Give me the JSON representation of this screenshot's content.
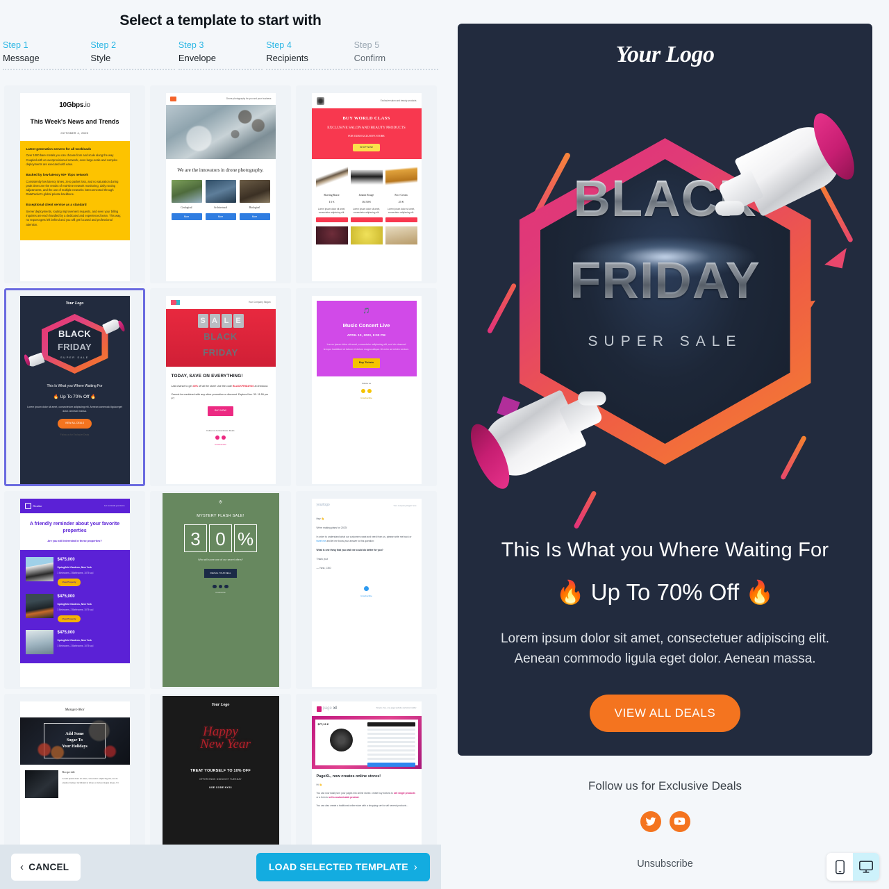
{
  "page": {
    "title": "Select a template to start with"
  },
  "steps": [
    {
      "num": "Step 1",
      "label": "Message",
      "active": true
    },
    {
      "num": "Step 2",
      "label": "Style",
      "active": true
    },
    {
      "num": "Step 3",
      "label": "Envelope",
      "active": true
    },
    {
      "num": "Step 4",
      "label": "Recipients",
      "active": true
    },
    {
      "num": "Step 5",
      "label": "Confirm",
      "active": false
    }
  ],
  "footer": {
    "cancel_label": "CANCEL",
    "load_label": "LOAD SELECTED TEMPLATE"
  },
  "templates": {
    "t1": {
      "logo": "10Gbps",
      "logo_suffix": ".io",
      "headline": "This Week's News and Trends",
      "date": "OCTOBER 4, 2022",
      "s1_title": "Latest generation servers for all workloads",
      "s1_body": "Over 1000 bare metals you can choose from and scale along the way. Coupled with an overprovisioned network, even large-scale and complex deployments are executed with ease.",
      "s2_title": "Backed by low-latency 90+ Tbps network",
      "s2_body": "Consistently low latency times, zero packet loss, and no saturation during peak times are the results of real-time network monitoring, daily routing adjustments, and the use of multiple networks interconnected through DataPacket's global private backbone.",
      "s3_title": "Exceptional client service as a standard",
      "s3_body": "Server deployments, routing improvement requests, and even your billing inquiries are each handled by a dedicated and experienced team. This way, no request gets left behind and you will get focused and professional attention."
    },
    "t2": {
      "tagline": "Drone photography for you and your business",
      "headline": "We are the innovators in drone photography.",
      "cols": [
        {
          "caption": "Geological",
          "button": "More"
        },
        {
          "caption": "Architectural",
          "button": "More"
        },
        {
          "caption": "Biological",
          "button": "More"
        }
      ]
    },
    "t3": {
      "tagline": "Exclusive salon and beauty products",
      "line1": "BUY WORLD CLASS",
      "line2": "EXCLUSIVE SALON AND BEAUTY PRODUCTS",
      "line3": "FOR OUR EXCLUSIVE STORE",
      "cta": "SHOP NOW",
      "products": [
        {
          "name": "Shaving Razor",
          "price": "15 €",
          "desc": "Lorem ipsum dolor sit amet, consectetur adipiscing elit."
        },
        {
          "name": "Jasmin Rouge",
          "price": "16.50 €",
          "desc": "Lorem ipsum dolor sit amet, consectetur adipiscing elit."
        },
        {
          "name": "Face Cream",
          "price": "25 €",
          "desc": "Lorem ipsum dolor sit amet, consectetur adipiscing elit."
        }
      ]
    },
    "t4": {
      "logo": "Your Logo",
      "title1": "BLACK",
      "title2": "FRIDAY",
      "subtitle": "SUPER SALE",
      "headline": "This Is What you Where Waiting For",
      "offer": "🔥 Up To 70% Off 🔥",
      "body": "Lorem ipsum dolor sit amet, consectetuer adipiscing elit. Aenean commodo ligula eget dolor. Aenean massa.",
      "cta": "VIEW ALL DEALS",
      "follow": "Follow us for Exclusive Deals",
      "selected": true
    },
    "t5": {
      "company": "Your Company Slogan",
      "sale": "SALE",
      "black": "BLACK",
      "friday": "FRIDAY",
      "headline": "TODAY, SAVE ON EVERYTHING!",
      "p1_a": "Last chance to get ",
      "p1_code": "40%",
      "p1_b": " off all the store! Use the code ",
      "p1_code2": "BLACKFRIDAY40",
      "p1_c": " at checkout.",
      "p2": "Cannot be combined with any other promotion or discount. Expires Nov. 30. 11:59 pm PT",
      "cta": "BUY NOW",
      "follow": "Follow us for Exclusive Deals",
      "unsubscribe": "Unsubscribe"
    },
    "t6": {
      "title": "Music Concert Live",
      "date": "APRIL 10, 2023, 8:00 PM",
      "body": "Lorem ipsum dolor sit amet, consectetur adipiscing elit, sed do eiusmod tempor incididunt ut labore et dolore magna aliqua. Ut enim ad minim veniam.",
      "cta": "Buy Tickets",
      "follow": "Follow us",
      "unsubscribe": "Unsubscribe"
    },
    "t7": {
      "logo": "Realtor",
      "tagline": "Let us Guide you Home",
      "headline": "A friendly reminder about your favorite properties",
      "sub": "Are you still interested in these properties?",
      "listings": [
        {
          "price": "$475,000",
          "address": "Springfield Gardens, New York",
          "details": "3 Bedrooms, 2 Bathrooms, 1075 sq.f.",
          "button": "View Property"
        },
        {
          "price": "$475,000",
          "address": "Springfield Gardens, New York",
          "details": "3 Bedrooms, 2 Bathrooms, 1075 sq.f.",
          "button": "View Property"
        },
        {
          "price": "$475,000",
          "address": "Springfield Gardens, New York",
          "details": "3 Bedrooms, 2 Bathrooms, 1075 sq.f.",
          "button": "View Property"
        }
      ]
    },
    "t8": {
      "headline": "MYSTERY FLASH SALE!",
      "d1": "3",
      "d2": "0",
      "d3": "%",
      "question": "Who will score one of our secret offers?",
      "cta": "REVEAL YOUR DEAL",
      "unsubscribe": "Unsubscribe"
    },
    "t9": {
      "logo": "your",
      "logo2": "logo",
      "tagline": "Your company slogan here",
      "greeting": "Hey 👋",
      "p1": "We're making plans for 2023!",
      "p2_a": "In order to understand what our customers want and need from us, please write me back or ",
      "p2_link": "tweet me",
      "p2_b": " and let me know your answer to this question:",
      "p3": "What is one thing that you wish we could do better for you?",
      "p4": "Thank you!",
      "p5": "— Yann, CEO",
      "unsubscribe": "Unsubscribe"
    },
    "t10": {
      "logo": "Mangez-Moi",
      "hero1": "Add Some",
      "hero2": "Sugar To",
      "hero3": "Your Holidays",
      "recipe_title": "Recipe title",
      "recipe_body": "Lorem ipsum dolor sit amet, consectetur adipiscing elit, sed do eiusmod tempor incididunt ut labore et dolore magna aliqua. Ut"
    },
    "t11": {
      "logo": "Your Logo",
      "art1": "Happy",
      "art2": "New Year",
      "headline": "TREAT YOURSELF TO 10% OFF",
      "sub": "OFFER ENDS MIDNIGHT TUESDAY",
      "code": "USE CODE NY23"
    },
    "t12": {
      "logo": "page",
      "logo2": "xl",
      "tagline": "Simple, free, one-page website and store builder",
      "price": "$77,19 €",
      "headline": "PageXL, now creates online stores!",
      "hi": "Hi 👋",
      "p1_a": "You can now easily turn your pages into online stores: create buy buttons to ",
      "p1_em": "sell single products",
      "p1_b": " or a form to ",
      "p1_em2": "sell a customizable product",
      "p1_c": ".",
      "p2": "You can also create a traditional online store with a shopping cart to sell several products..."
    }
  },
  "preview": {
    "logo": "Your Logo",
    "title1": "BLACK",
    "title2": "FRIDAY",
    "subtitle": "SUPER SALE",
    "headline": "This Is What you Where Waiting For",
    "offer": "🔥 Up To 70% Off 🔥",
    "body": "Lorem ipsum dolor sit amet, consectetuer adipiscing elit. Aenean commodo ligula eget dolor. Aenean massa.",
    "cta": "VIEW ALL DEALS",
    "follow": "Follow us for Exclusive Deals",
    "unsubscribe": "Unsubscribe",
    "accent_orange": "#f4741f",
    "bg_dark": "#222b3e"
  },
  "device_toggle": {
    "mobile": "mobile-view",
    "desktop": "desktop-view",
    "active": "desktop"
  }
}
